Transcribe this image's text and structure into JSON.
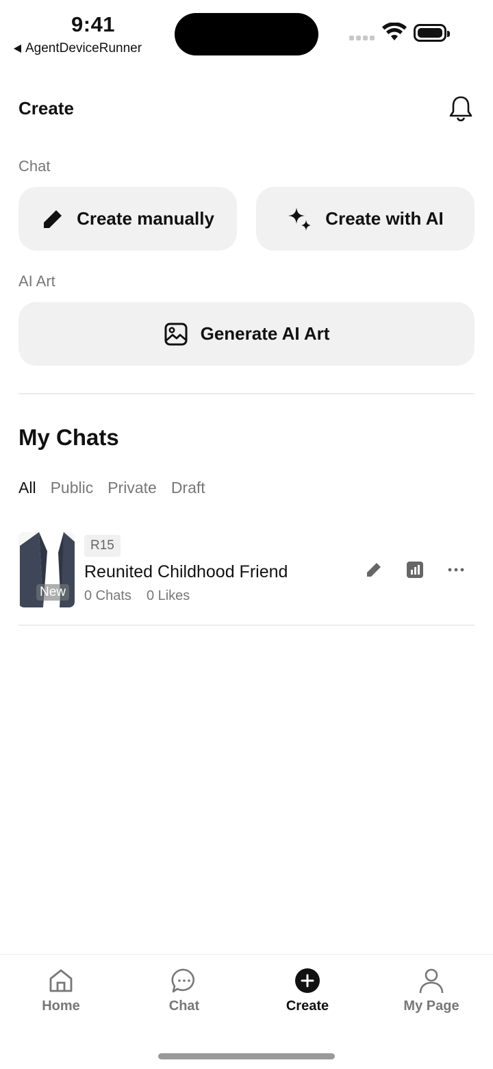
{
  "status_bar": {
    "time": "9:41",
    "back_app": "AgentDeviceRunner"
  },
  "header": {
    "title": "Create",
    "notification_icon": "bell-icon"
  },
  "chat_section": {
    "label": "Chat",
    "create_manually_label": "Create manually",
    "create_manually_icon": "pencil-icon",
    "create_ai_label": "Create with AI",
    "create_ai_icon": "sparkles-icon"
  },
  "art_section": {
    "label": "AI Art",
    "generate_label": "Generate AI Art",
    "generate_icon": "image-icon"
  },
  "my_chats": {
    "title": "My Chats",
    "tabs": [
      {
        "label": "All",
        "active": true
      },
      {
        "label": "Public",
        "active": false
      },
      {
        "label": "Private",
        "active": false
      },
      {
        "label": "Draft",
        "active": false
      }
    ],
    "items": [
      {
        "rating": "R15",
        "title": "Reunited Childhood Friend",
        "chats": "0 Chats",
        "likes": "0 Likes",
        "badge": "New",
        "actions": [
          "pencil-icon",
          "stats-icon",
          "more-icon"
        ]
      }
    ]
  },
  "bottom_nav": {
    "items": [
      {
        "label": "Home",
        "icon": "home-icon",
        "active": false
      },
      {
        "label": "Chat",
        "icon": "chat-bubble-icon",
        "active": false
      },
      {
        "label": "Create",
        "icon": "plus-circle-icon",
        "active": true
      },
      {
        "label": "My Page",
        "icon": "person-icon",
        "active": false
      }
    ]
  },
  "colors": {
    "button_bg": "#f1f1f1",
    "muted_text": "#777777",
    "primary_text": "#111111"
  }
}
